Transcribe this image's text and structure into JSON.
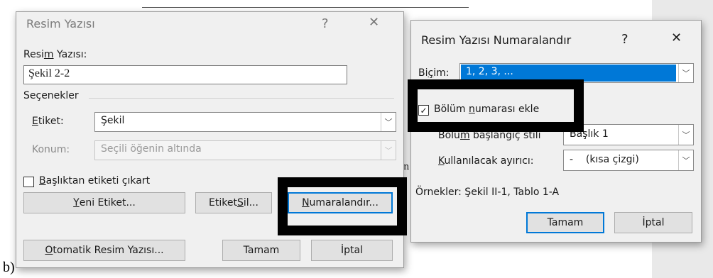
{
  "figure_label": "b)",
  "background": {
    "stray_letter": "n"
  },
  "caption_dialog": {
    "title": "Resim Yazısı",
    "help": "?",
    "close": "✕",
    "caption_label": {
      "pre": "Resi",
      "u": "m",
      "post": " Yazısı:"
    },
    "caption_value": "Şekil 2-2",
    "options_heading": "Seçenekler",
    "label_label": {
      "pre": "",
      "u": "E",
      "post": "tiket:"
    },
    "label_value": "Şekil",
    "position_label": "Konum:",
    "position_value": "Seçili öğenin altında",
    "exclude_label": {
      "pre": "",
      "u": "B",
      "post": "aşlıktan etiketi çıkart"
    },
    "new_label_button": {
      "pre": "",
      "u": "Y",
      "post": "eni Etiket..."
    },
    "delete_label_button": {
      "pre": "Etiket ",
      "u": "S",
      "post": "il..."
    },
    "numbering_button": {
      "pre": "",
      "u": "N",
      "post": "umaralandır..."
    },
    "autocaption_button": {
      "pre": "",
      "u": "O",
      "post": "tomatik Resim Yazısı..."
    },
    "ok_button": "Tamam",
    "cancel_button": "İptal"
  },
  "numbering_dialog": {
    "title": "Resim Yazısı Numaralandır",
    "help": "?",
    "close": "✕",
    "format_label": {
      "pre": "Bi",
      "u": "ç",
      "post": "im:"
    },
    "format_value": "1, 2, 3, ...",
    "include_chapter_label": {
      "pre": "Bölüm ",
      "u": "n",
      "post": "umarası ekle"
    },
    "include_chapter_checked": true,
    "chapter_style_label": {
      "pre": "Bölü",
      "u": "m",
      "post": " başlangıç stili"
    },
    "chapter_style_value": "Başlık 1",
    "separator_label": {
      "pre": "",
      "u": "K",
      "post": "ullanılacak ayırıcı:"
    },
    "separator_value": "-    (kısa çizgi)",
    "examples": "Örnekler:  Şekil II-1, Tablo 1-A",
    "ok_button": "Tamam",
    "cancel_button": "İptal"
  }
}
